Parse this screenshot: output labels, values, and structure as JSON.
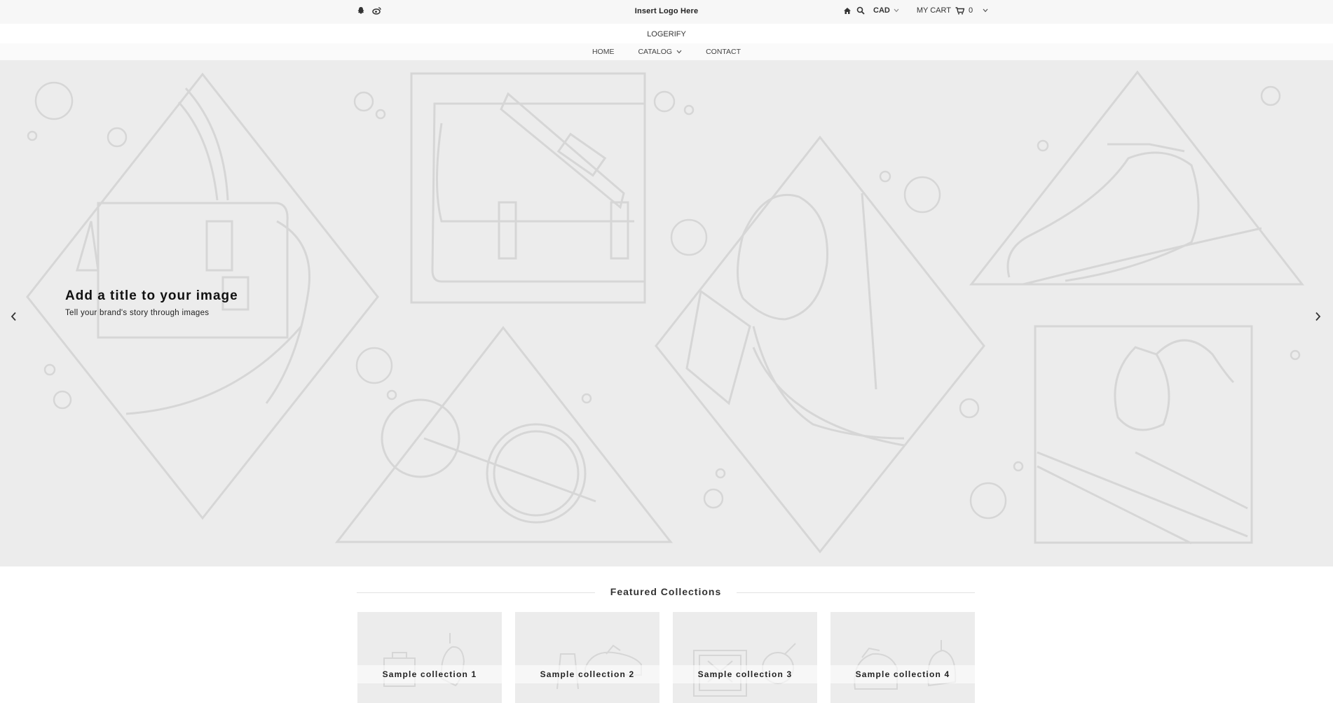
{
  "topbar": {
    "social_icons": [
      "snapchat-icon",
      "weibo-icon"
    ],
    "logo_text": "Insert Logo Here",
    "currency": "CAD",
    "cart_label": "MY CART",
    "cart_count": "0"
  },
  "brand": "LOGERIFY",
  "nav": {
    "home": "HOME",
    "catalog": "CATALOG",
    "contact": "CONTACT"
  },
  "hero": {
    "title": "Add a title to your image",
    "subtitle": "Tell your brand's story through images"
  },
  "featured": {
    "heading": "Featured Collections",
    "collections": [
      {
        "label": "Sample collection 1"
      },
      {
        "label": "Sample collection 2"
      },
      {
        "label": "Sample collection 3"
      },
      {
        "label": "Sample collection 4"
      }
    ]
  },
  "colors": {
    "hero_bg": "#ececec",
    "line_art": "#d6d6d6",
    "topbar_bg": "#f7f7f7"
  }
}
